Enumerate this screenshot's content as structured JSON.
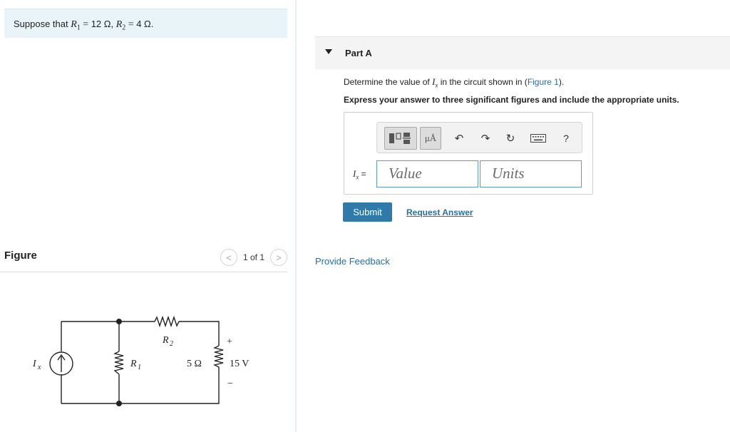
{
  "problem": {
    "prefix": "Suppose that ",
    "r1_symbol": "R",
    "r1_sub": "1",
    "r1_eq": " = ",
    "r1_value": "12 Ω",
    "sep": ", ",
    "r2_symbol": "R",
    "r2_sub": "2",
    "r2_eq": " = ",
    "r2_value": "4 Ω",
    "end": "."
  },
  "figure": {
    "title": "Figure",
    "pager": {
      "prev": "<",
      "text": "1 of 1",
      "next": ">"
    },
    "circuit_labels": {
      "ix": "I",
      "ix_sub": "x",
      "r1": "R",
      "r1_sub": "1",
      "r2": "R",
      "r2_sub": "2",
      "r3": "5 Ω",
      "v_plus": "+",
      "v_minus": "−",
      "voltage": "15 V"
    }
  },
  "part": {
    "caret": "▼",
    "title": "Part A",
    "question_prefix": "Determine the value of ",
    "question_var": "I",
    "question_var_sub": "x",
    "question_mid": " in the circuit shown in (",
    "question_link": "Figure 1",
    "question_suffix": ").",
    "instruction": "Express your answer to three significant figures and include the appropriate units."
  },
  "toolbar": {
    "units_label": "μÅ",
    "undo": "↶",
    "redo": "↷",
    "reset": "↻",
    "help": "?"
  },
  "answer": {
    "var": "I",
    "var_sub": "x",
    "eq": " =",
    "value_placeholder": "Value",
    "units_placeholder": "Units"
  },
  "buttons": {
    "submit": "Submit",
    "request_answer": "Request Answer",
    "feedback": "Provide Feedback"
  }
}
